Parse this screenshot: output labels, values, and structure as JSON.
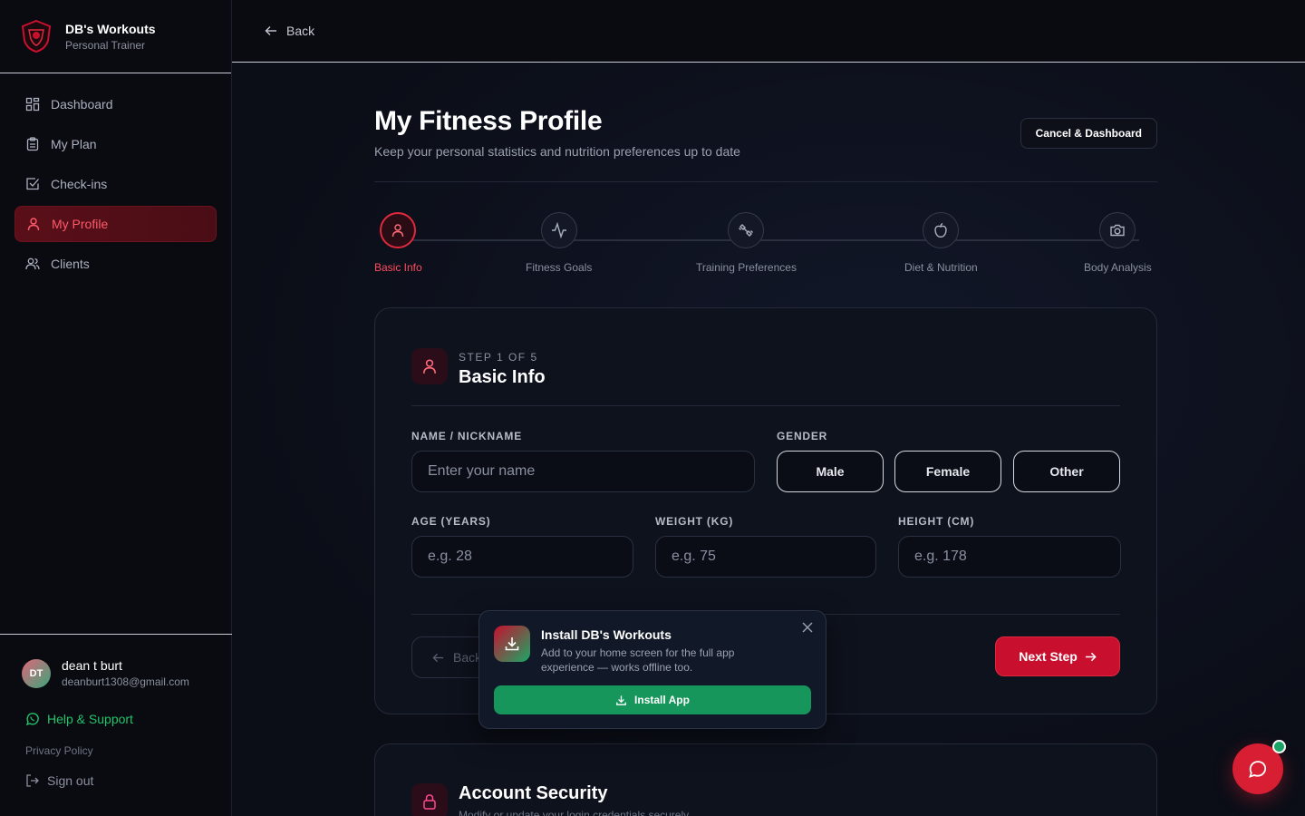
{
  "brand": {
    "title": "DB's Workouts",
    "subtitle": "Personal Trainer"
  },
  "nav": {
    "items": [
      {
        "label": "Dashboard",
        "icon": "dashboard-icon"
      },
      {
        "label": "My Plan",
        "icon": "clipboard-icon"
      },
      {
        "label": "Check-ins",
        "icon": "check-square-icon"
      },
      {
        "label": "My Profile",
        "icon": "user-icon",
        "active": true
      },
      {
        "label": "Clients",
        "icon": "users-icon"
      }
    ]
  },
  "user": {
    "initials": "DT",
    "name": "dean t burt",
    "email": "deanburt1308@gmail.com"
  },
  "sidebar_footer": {
    "help": "Help & Support",
    "privacy": "Privacy Policy",
    "signout": "Sign out"
  },
  "topbar": {
    "back": "Back"
  },
  "page": {
    "title": "My Fitness Profile",
    "subtitle": "Keep your personal statistics and nutrition preferences up to date",
    "cancel_button": "Cancel & Dashboard"
  },
  "steps": [
    {
      "label": "Basic Info",
      "icon": "user-icon",
      "active": true
    },
    {
      "label": "Fitness Goals",
      "icon": "activity-icon"
    },
    {
      "label": "Training Preferences",
      "icon": "dumbbell-icon"
    },
    {
      "label": "Diet & Nutrition",
      "icon": "apple-icon"
    },
    {
      "label": "Body Analysis",
      "icon": "camera-icon"
    }
  ],
  "card": {
    "step_text": "STEP 1 OF 5",
    "title": "Basic Info",
    "name_label": "NAME / NICKNAME",
    "name_placeholder": "Enter your name",
    "gender_label": "GENDER",
    "gender_options": [
      "Male",
      "Female",
      "Other"
    ],
    "age_label": "AGE (YEARS)",
    "age_placeholder": "e.g. 28",
    "weight_label": "WEIGHT (KG)",
    "weight_placeholder": "e.g. 75",
    "height_label": "HEIGHT (CM)",
    "height_placeholder": "e.g. 178",
    "back_button": "Back",
    "next_button": "Next Step"
  },
  "security_card": {
    "title": "Account Security",
    "subtitle": "Modify or update your login credentials securely"
  },
  "install_popup": {
    "title": "Install DB's Workouts",
    "description": "Add to your home screen for the full app experience — works offline too.",
    "button": "Install App"
  },
  "colors": {
    "accent": "#c8102e",
    "success": "#17965c",
    "background": "#0b0e17"
  }
}
